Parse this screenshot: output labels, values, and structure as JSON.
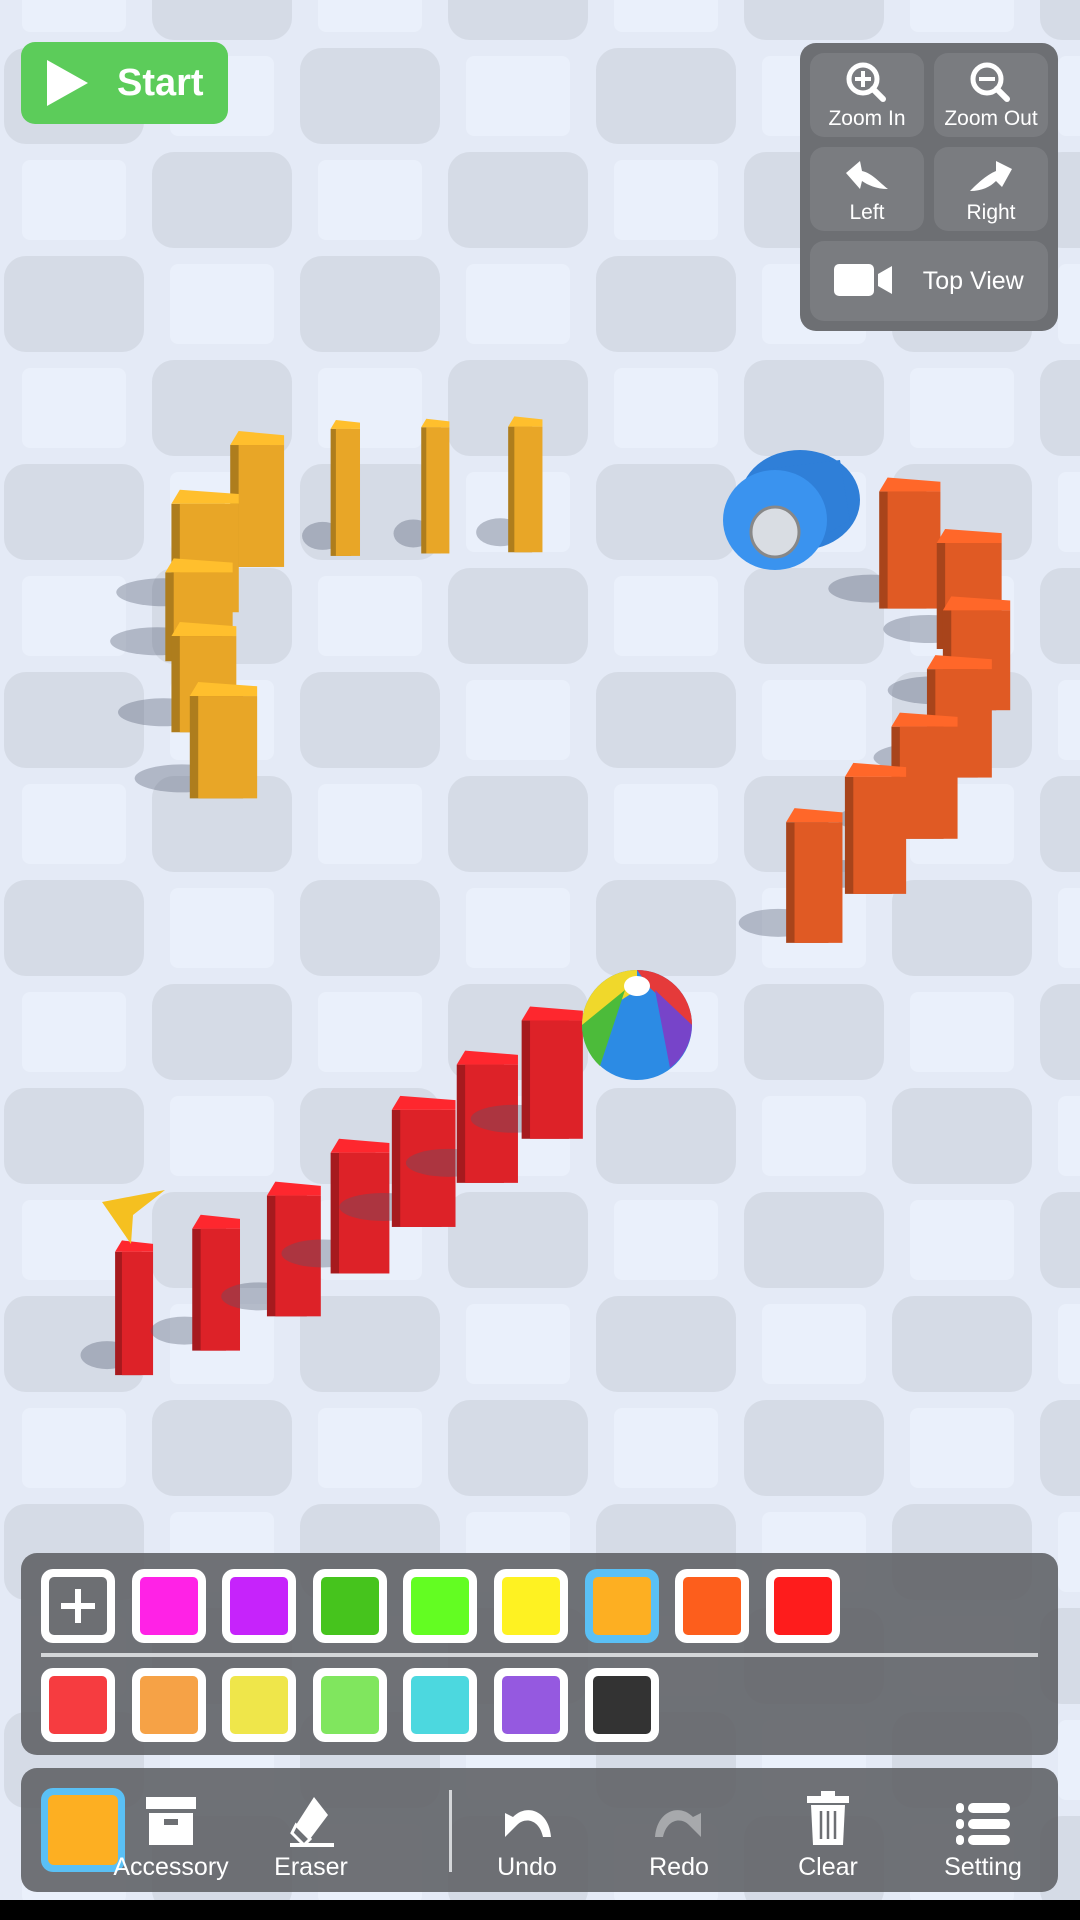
{
  "start_button": {
    "label": "Start",
    "icon": "play-icon",
    "color": "#5ccc5a"
  },
  "camera_controls": {
    "zoom_in": {
      "label": "Zoom In",
      "icon": "zoom-in-icon"
    },
    "zoom_out": {
      "label": "Zoom Out",
      "icon": "zoom-out-icon"
    },
    "rotate_left": {
      "label": "Left",
      "icon": "rotate-left-arrow-icon"
    },
    "rotate_right": {
      "label": "Right",
      "icon": "rotate-right-arrow-icon"
    },
    "top_view": {
      "label": "Top View",
      "icon": "video-camera-icon"
    }
  },
  "palette": {
    "row1": [
      "add",
      "#ff22e6",
      "#c623fb",
      "#46c41d",
      "#63fd22",
      "#fef222",
      "#fdaf22",
      "#fd5e1c",
      "#fe1c1c"
    ],
    "row2": [
      "#f63c40",
      "#f6a246",
      "#efe64a",
      "#80e65e",
      "#4cd8df",
      "#9559e0",
      "#333333"
    ],
    "selected": "#fdaf22"
  },
  "toolbar": {
    "current_color": "#fdaf22",
    "accessory": "Accessory",
    "eraser": "Eraser",
    "undo": "Undo",
    "redo": "Redo",
    "clear": "Clear",
    "setting": "Setting"
  },
  "scene": {
    "domino_colors": {
      "yellow": "#e8a627",
      "orange": "#e05a24",
      "red": "#dd2228"
    },
    "objects": [
      "dominoes",
      "beach-ball",
      "tape-roll",
      "start-marker-arrow"
    ]
  }
}
